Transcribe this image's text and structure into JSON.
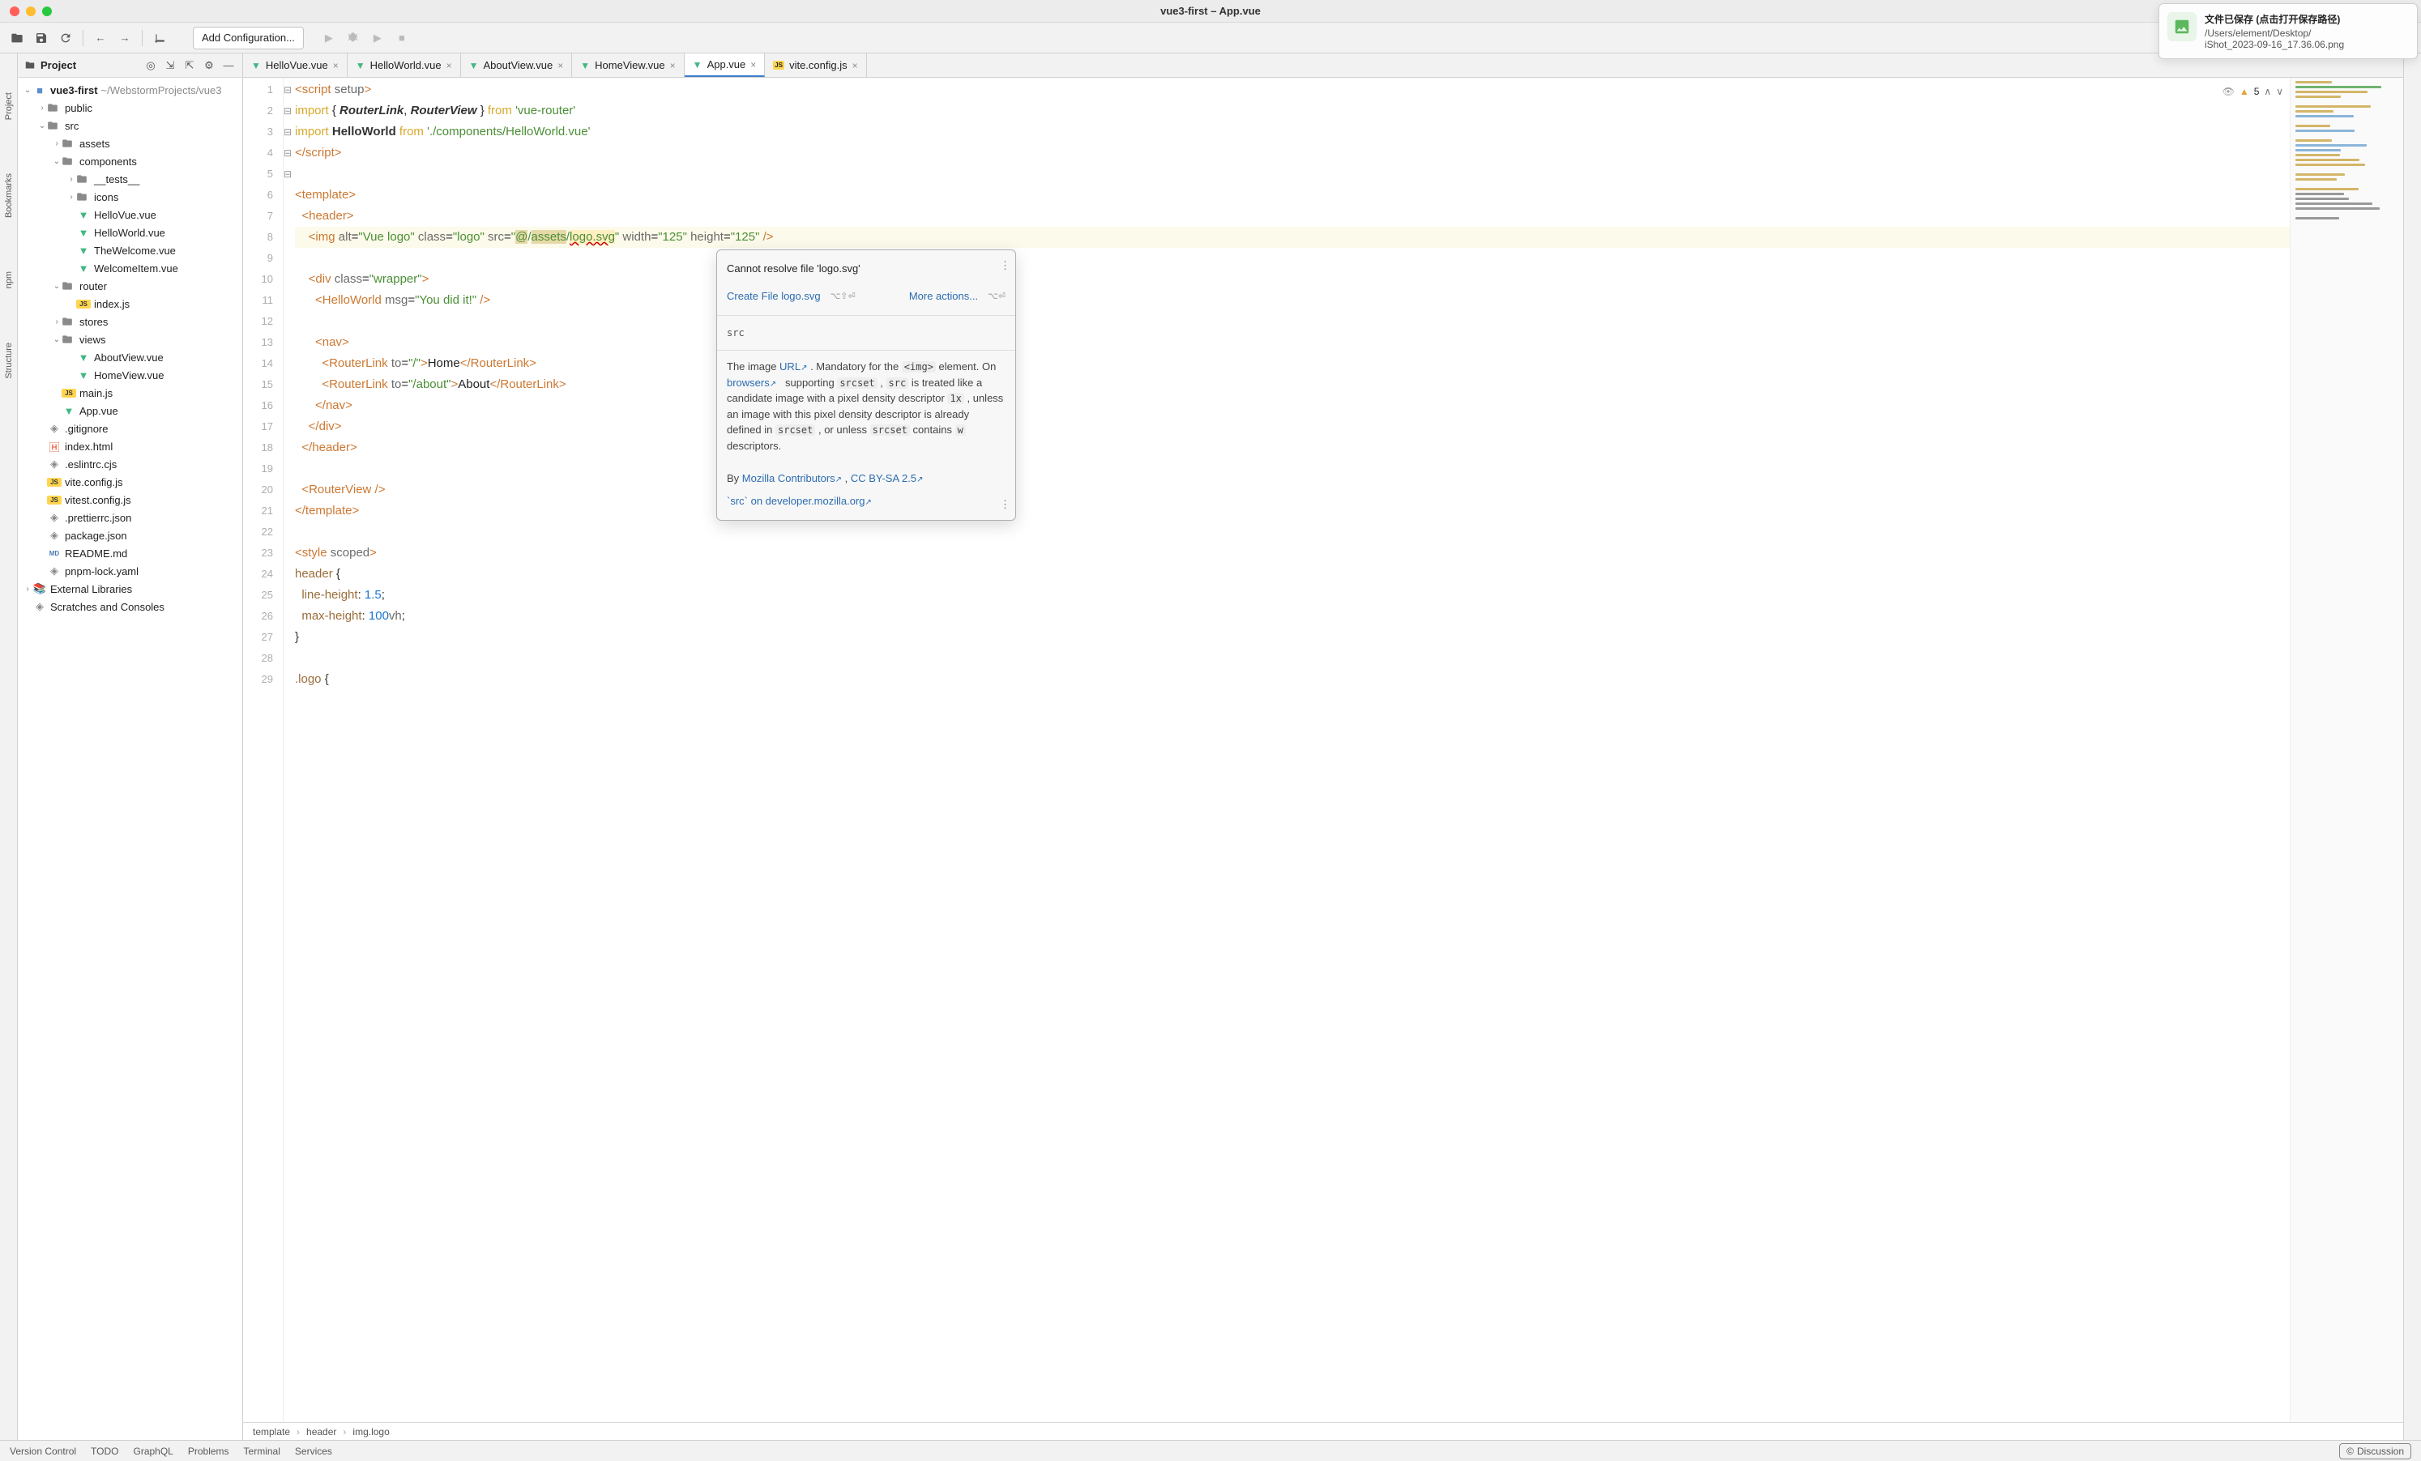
{
  "window_title": "vue3-first – App.vue",
  "toolbar": {
    "config_label": "Add Configuration..."
  },
  "left_tabs": [
    "Project",
    "Bookmarks",
    "npm",
    "Structure"
  ],
  "project": {
    "header": "Project",
    "root_label": "vue3-first",
    "root_path": "~/WebstormProjects/vue3",
    "nodes": [
      {
        "indent": 1,
        "arrow": "›",
        "icon": "📁",
        "label": "public"
      },
      {
        "indent": 1,
        "arrow": "⌄",
        "icon": "📁",
        "label": "src"
      },
      {
        "indent": 2,
        "arrow": "›",
        "icon": "📁",
        "label": "assets"
      },
      {
        "indent": 2,
        "arrow": "⌄",
        "icon": "📁",
        "label": "components"
      },
      {
        "indent": 3,
        "arrow": "›",
        "icon": "📁",
        "label": "__tests__"
      },
      {
        "indent": 3,
        "arrow": "›",
        "icon": "📁",
        "label": "icons"
      },
      {
        "indent": 3,
        "arrow": "",
        "icon": "V",
        "label": "HelloVue.vue"
      },
      {
        "indent": 3,
        "arrow": "",
        "icon": "V",
        "label": "HelloWorld.vue"
      },
      {
        "indent": 3,
        "arrow": "",
        "icon": "V",
        "label": "TheWelcome.vue"
      },
      {
        "indent": 3,
        "arrow": "",
        "icon": "V",
        "label": "WelcomeItem.vue"
      },
      {
        "indent": 2,
        "arrow": "⌄",
        "icon": "📁",
        "label": "router"
      },
      {
        "indent": 3,
        "arrow": "",
        "icon": "JS",
        "label": "index.js"
      },
      {
        "indent": 2,
        "arrow": "›",
        "icon": "📁",
        "label": "stores"
      },
      {
        "indent": 2,
        "arrow": "⌄",
        "icon": "📁",
        "label": "views"
      },
      {
        "indent": 3,
        "arrow": "",
        "icon": "V",
        "label": "AboutView.vue"
      },
      {
        "indent": 3,
        "arrow": "",
        "icon": "V",
        "label": "HomeView.vue"
      },
      {
        "indent": 2,
        "arrow": "",
        "icon": "JS",
        "label": "main.js"
      },
      {
        "indent": 2,
        "arrow": "",
        "icon": "V",
        "label": "App.vue"
      },
      {
        "indent": 1,
        "arrow": "",
        "icon": "◘",
        "label": ".gitignore"
      },
      {
        "indent": 1,
        "arrow": "",
        "icon": "H",
        "label": "index.html"
      },
      {
        "indent": 1,
        "arrow": "",
        "icon": "◘",
        "label": ".eslintrc.cjs"
      },
      {
        "indent": 1,
        "arrow": "",
        "icon": "JS",
        "label": "vite.config.js"
      },
      {
        "indent": 1,
        "arrow": "",
        "icon": "JS",
        "label": "vitest.config.js"
      },
      {
        "indent": 1,
        "arrow": "",
        "icon": "◘",
        "label": ".prettierrc.json"
      },
      {
        "indent": 1,
        "arrow": "",
        "icon": "◘",
        "label": "package.json"
      },
      {
        "indent": 1,
        "arrow": "",
        "icon": "MD",
        "label": "README.md"
      },
      {
        "indent": 1,
        "arrow": "",
        "icon": "◘",
        "label": "pnpm-lock.yaml"
      },
      {
        "indent": 0,
        "arrow": "›",
        "icon": "📚",
        "label": "External Libraries"
      },
      {
        "indent": 0,
        "arrow": "",
        "icon": "◘",
        "label": "Scratches and Consoles"
      }
    ]
  },
  "editor_tabs": [
    {
      "label": "HelloVue.vue",
      "ico": "V",
      "active": false
    },
    {
      "label": "HelloWorld.vue",
      "ico": "V",
      "active": false
    },
    {
      "label": "AboutView.vue",
      "ico": "V",
      "active": false
    },
    {
      "label": "HomeView.vue",
      "ico": "V",
      "active": false
    },
    {
      "label": "App.vue",
      "ico": "V",
      "active": true
    },
    {
      "label": "vite.config.js",
      "ico": "JS",
      "active": false
    }
  ],
  "inspection": {
    "warn_count": "5"
  },
  "popup": {
    "title": "Cannot resolve file 'logo.svg'",
    "create_action": "Create File logo.svg",
    "more_action": "More actions...",
    "src_label": "src",
    "body_pre": "The image ",
    "url_link": "URL",
    "body_1": " . Mandatory for the ",
    "code1": "<img>",
    "body_2": " element. On ",
    "browsers_link": "browsers",
    "body_3": " supporting ",
    "code2": "srcset",
    "body_4": " , ",
    "code3": "src",
    "body_5": " is treated like a candidate image with a pixel density descriptor ",
    "code4": "1x",
    "body_6": " , unless an image with this pixel density descriptor is already defined in ",
    "code5": "srcset",
    "body_7": " , or unless ",
    "code6": "srcset",
    "body_8": " contains ",
    "code7": "w",
    "body_9": " descriptors.",
    "by_label": "By ",
    "contrib_link": "Mozilla Contributors",
    "comma": " , ",
    "license_link": "CC BY-SA 2.5",
    "mdn_link": "`src` on developer.mozilla.org"
  },
  "toast": {
    "title": "文件已保存 (点击打开保存路径)",
    "path": "/Users/element/Desktop/",
    "file": "iShot_2023-09-16_17.36.06.png"
  },
  "breadcrumb": [
    "template",
    "header",
    "img.logo"
  ],
  "bottombar": {
    "items": [
      "Version Control",
      "TODO",
      "GraphQL",
      "Problems",
      "Terminal",
      "Services"
    ],
    "discussion": "Discussion"
  },
  "code_lines": [
    "<script setup>",
    "import { RouterLink, RouterView } from 'vue-router'",
    "import HelloWorld from './components/HelloWorld.vue'",
    "</script>",
    "",
    "<template>",
    "  <header>",
    "    <img alt=\"Vue logo\" class=\"logo\" src=\"@/assets/logo.svg\" width=\"125\" height=\"125\" />",
    "",
    "    <div class=\"wrapper\">",
    "      <HelloWorld msg=\"You did it!\" />",
    "",
    "      <nav>",
    "        <RouterLink to=\"/\">Home</RouterLink>",
    "        <RouterLink to=\"/about\">About</RouterLink>",
    "      </nav>",
    "    </div>",
    "  </header>",
    "",
    "  <RouterView />",
    "</template>",
    "",
    "<style scoped>",
    "header {",
    "  line-height: 1.5;",
    "  max-height: 100vh;",
    "}",
    "",
    ".logo {"
  ]
}
